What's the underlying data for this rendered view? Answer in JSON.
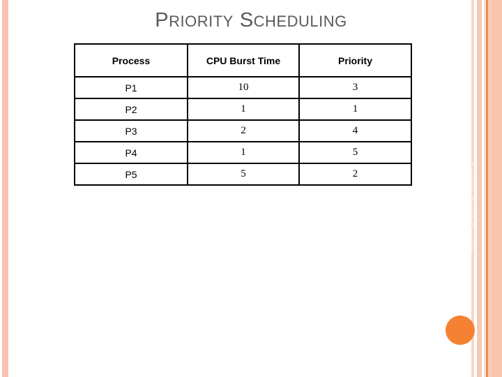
{
  "slide": {
    "title_parts": [
      {
        "text": "P",
        "style": "cap"
      },
      {
        "text": "RIORITY",
        "style": "sc"
      },
      {
        "text": "S",
        "style": "cap"
      },
      {
        "text": "CHEDULING",
        "style": "sc"
      }
    ],
    "title_plain": "PRIORITY SCHEDULING",
    "footer_text": "Operating System Concepts",
    "colors": {
      "title": "#595959",
      "accent_circle": "#f58233",
      "stripe_peach": "#f6c3b0",
      "stripe_orange": "#e98f4e",
      "table_border": "#000000",
      "background": "#ffffff"
    }
  },
  "table": {
    "headers": [
      "Process",
      "CPU Burst Time",
      "Priority"
    ],
    "rows": [
      {
        "process": "P1",
        "burst": "10",
        "priority": "3"
      },
      {
        "process": "P2",
        "burst": "1",
        "priority": "1"
      },
      {
        "process": "P3",
        "burst": "2",
        "priority": "4"
      },
      {
        "process": "P4",
        "burst": "1",
        "priority": "5"
      },
      {
        "process": "P5",
        "burst": "5",
        "priority": "2"
      }
    ]
  }
}
